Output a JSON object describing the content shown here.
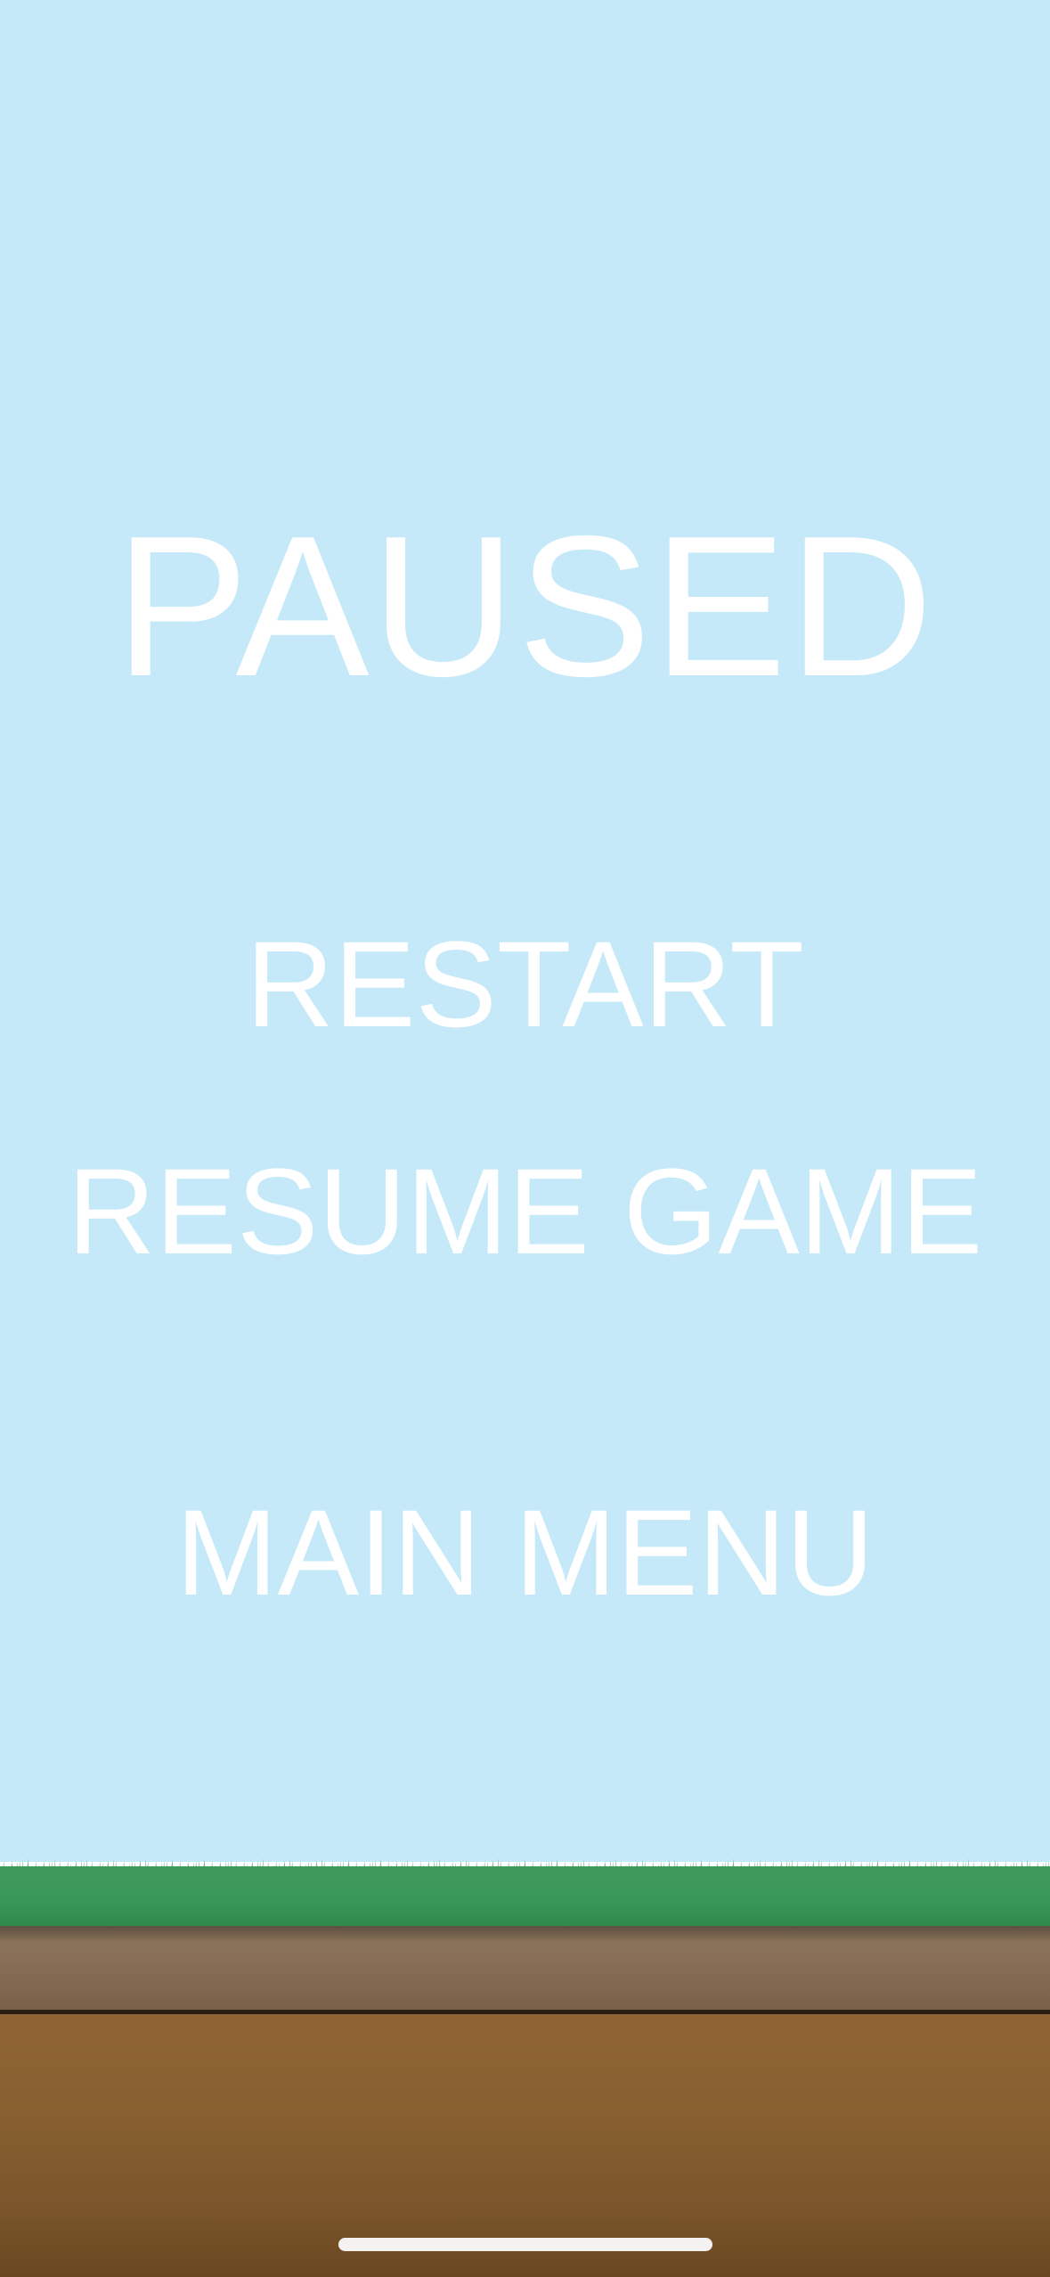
{
  "theme": {
    "sky_color": "#c5e9f9",
    "text_color": "#ffffff",
    "grass_color": "#39975a",
    "soil_color": "#855e2f",
    "dirt_top_color": "#846a52"
  },
  "pause_menu": {
    "title": "PAUSED",
    "buttons": {
      "restart": "RESTART",
      "resume": "RESUME GAME",
      "main_menu": "MAIN MENU"
    }
  }
}
